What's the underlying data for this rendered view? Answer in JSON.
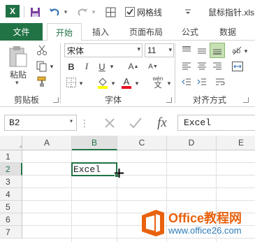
{
  "titlebar": {
    "app_logo": "X",
    "gridlines_label": "网格线",
    "file_name": "鼠标指针.xls"
  },
  "tabs": [
    "文件",
    "开始",
    "插入",
    "页面布局",
    "公式",
    "数据"
  ],
  "ribbon": {
    "paste_label": "粘贴",
    "clipboard_label": "剪贴板",
    "font_name": "宋体",
    "font_size": "11",
    "font_label": "字体",
    "align_label": "对齐方式",
    "phonetic_label": "wén"
  },
  "formula_bar": {
    "name_box": "B2",
    "fx_label": "fx",
    "content": "Excel"
  },
  "grid": {
    "columns": [
      "A",
      "B",
      "C",
      "D",
      "E"
    ],
    "rows": [
      "1",
      "2",
      "3",
      "4",
      "5",
      "6",
      "7"
    ],
    "b2_value": "Excel"
  },
  "watermark": {
    "name": "Office教程网",
    "url": "www.office26.com"
  },
  "colors": {
    "accent_green": "#217346",
    "watermark_orange": "#e8620e",
    "watermark_blue": "#2d7bb8"
  }
}
